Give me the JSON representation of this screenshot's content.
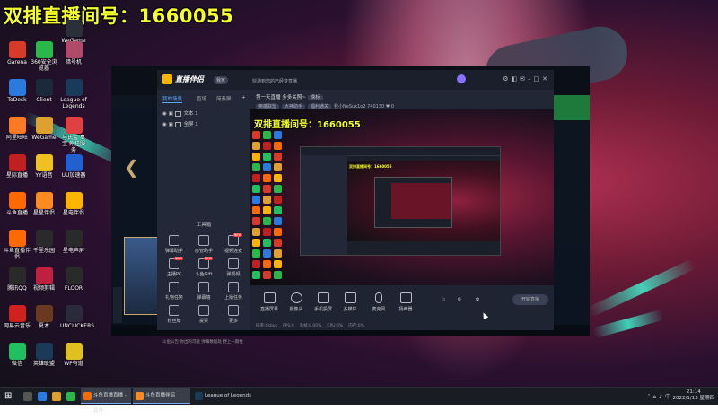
{
  "overlay_title": "双排直播间号：1660055",
  "desktop_icons": [
    {
      "label": "WeGame版",
      "color": "#2a2f3a"
    },
    {
      "label": "Garena",
      "color": "#d83a2a"
    },
    {
      "label": "360安全浏览器",
      "color": "#2ab84a"
    },
    {
      "label": "暗号机",
      "color": "#b04a6a"
    },
    {
      "label": "ToDesk",
      "color": "#2a7ae0"
    },
    {
      "label": "Client",
      "color": "#1a2a3a"
    },
    {
      "label": "League of Legends",
      "color": "#1a3a5a"
    },
    {
      "label": "阿里旺旺",
      "color": "#ff7a20"
    },
    {
      "label": "WeGame",
      "color": "#e0a030"
    },
    {
      "label": "与氏宝 桌宝 外挂服务",
      "color": "#e04040"
    },
    {
      "label": "星际直播",
      "color": "#c02020"
    },
    {
      "label": "YY语音",
      "color": "#f0c020"
    },
    {
      "label": "UU加速器",
      "color": "#2060d0"
    },
    {
      "label": "斗鱼直播",
      "color": "#ff6a00"
    },
    {
      "label": "星星伴侣",
      "color": "#ff8a20"
    },
    {
      "label": "星电伴侣",
      "color": "#ffb400"
    },
    {
      "label": "斗鱼直播伴侣",
      "color": "#ff6a00"
    },
    {
      "label": "千里乐园",
      "color": "#2a2a2a"
    },
    {
      "label": "星电声屏",
      "color": "#2a2a2a"
    },
    {
      "label": "腾讯QQ",
      "color": "#2a2a2a"
    },
    {
      "label": "视频剪辑",
      "color": "#c02040"
    },
    {
      "label": "FLOOR",
      "color": "#2a2a2a"
    },
    {
      "label": "网易云音乐",
      "color": "#d02020"
    },
    {
      "label": "夏木",
      "color": "#6a3a20"
    },
    {
      "label": "UNCLICKERS",
      "color": "#2a2a3a"
    },
    {
      "label": "微信",
      "color": "#20c060"
    },
    {
      "label": "英雄联盟",
      "color": "#1a3a5a"
    },
    {
      "label": "WP有道",
      "color": "#e0c020"
    }
  ],
  "app": {
    "logo_text": "直播伴侣",
    "version_tag": "我家",
    "notice": "监测到您的已经变直播",
    "sidebar_tabs": [
      "我的场景",
      "直场",
      "简素屏"
    ],
    "scenes": [
      "文本 1",
      "全屏 1"
    ],
    "toolbox_title": "工具箱",
    "tools": [
      {
        "label": "弹幕助手",
        "badge": ""
      },
      {
        "label": "房管助手",
        "badge": ""
      },
      {
        "label": "视频连麦",
        "badge": "NEW"
      },
      {
        "label": "主播PK",
        "badge": "NEW"
      },
      {
        "label": "斗鱼Gift",
        "badge": "NEW"
      },
      {
        "label": "弹观频",
        "badge": ""
      },
      {
        "label": "礼物任务",
        "badge": ""
      },
      {
        "label": "弹幕墙",
        "badge": ""
      },
      {
        "label": "上播任务",
        "badge": ""
      },
      {
        "label": "粉丝牌",
        "badge": ""
      },
      {
        "label": "投票",
        "badge": ""
      },
      {
        "label": "更多",
        "badge": ""
      }
    ],
    "sidebar_footer": "斗鱼公告 你出的可能 弹幕数据处 野上一期性",
    "room_title": "第一天直播 多多关照~",
    "room_tag": "换标",
    "room_meta": [
      "英雄联盟",
      "大神助手"
    ],
    "room_extra": "福利通关",
    "room_id": "我小NeSuk1o2  740130  ",
    "room_likes": "0",
    "preview_text": "双排直播间号：1660055",
    "controls": [
      {
        "label": "直播屏幕",
        "icon": "monitor-icon"
      },
      {
        "label": "摄像头",
        "icon": "camera-icon"
      },
      {
        "label": "手机投屏",
        "icon": "phone-icon"
      },
      {
        "label": "多媒体",
        "icon": "media-icon"
      },
      {
        "label": "麦克风",
        "icon": "mic-icon"
      },
      {
        "label": "扬声器",
        "icon": "speaker-icon"
      }
    ],
    "start_button": "开始直播",
    "status_items": [
      "码率:0kbps",
      "FPS:0",
      "丢帧:0.00%",
      "CPU:0%",
      "内存:0%"
    ]
  },
  "taskbar": {
    "tasks": [
      {
        "label": "斗鱼直播直播 - 夏林",
        "color": "#ff6a00",
        "active": true
      },
      {
        "label": "斗鱼直播伴侣",
        "color": "#ff8a20",
        "active": true
      },
      {
        "label": "League of Legends",
        "color": "#1a3a5a",
        "active": false
      }
    ],
    "time": "21:14",
    "date": "2022/1/13 星期四"
  }
}
